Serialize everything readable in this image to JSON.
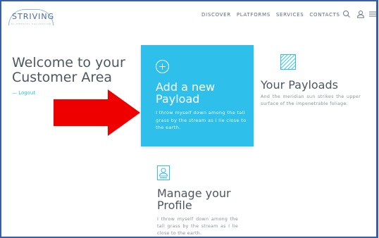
{
  "header": {
    "logo_text": "STRIVING",
    "logo_tagline": "HI-DENSITY VALIDATION",
    "nav": [
      "DISCOVER",
      "PLATFORMS",
      "SERVICES",
      "CONTACTS"
    ],
    "icons": [
      "search-icon",
      "user-icon",
      "menu-icon"
    ]
  },
  "welcome": {
    "title": "Welcome to your Customer Area",
    "logout_label": "— Logout"
  },
  "annotation": {
    "arrow_color": "#ee0000"
  },
  "cards": {
    "add_payload": {
      "title": "Add a new Payload",
      "text": "I throw myself down among the tall grass by the stream as I lie close to the earth.",
      "color": "#2ec0ea",
      "icon": "plus-circle-icon"
    },
    "your_payloads": {
      "title": "Your Payloads",
      "text": "And the meridian sun strikes the upper surface of the impenetrable foliage.",
      "icon": "hatched-square-icon"
    },
    "manage_profile": {
      "title": "Manage your Profile",
      "text": "I throw myself down among the tall grass by the stream as I lie close to the earth.",
      "icon": "profile-card-icon"
    }
  },
  "colors": {
    "accent": "#2ec0ea",
    "frame": "#3a5fa0",
    "heading": "#4e5760"
  }
}
